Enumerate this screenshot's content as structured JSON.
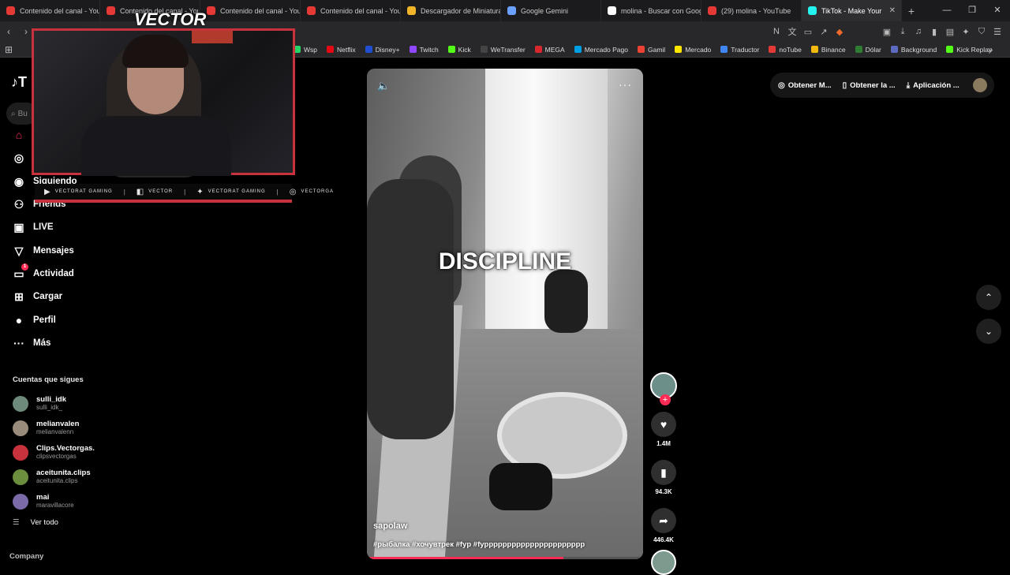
{
  "browser": {
    "tabs": [
      {
        "label": "Contenido del canal - You",
        "color": "#e53935"
      },
      {
        "label": "Contenido del canal - You",
        "color": "#e53935"
      },
      {
        "label": "Contenido del canal - You",
        "color": "#e53935"
      },
      {
        "label": "Contenido del canal - You",
        "color": "#e53935"
      },
      {
        "label": "Descargador de Miniatura",
        "color": "#f0b429"
      },
      {
        "label": "Google Gemini",
        "color": "#6aa0ff"
      },
      {
        "label": "molina - Buscar con Goog",
        "color": "#ffffff"
      },
      {
        "label": "(29) molina - YouTube",
        "color": "#e53935"
      },
      {
        "label": "TikTok - Make Your",
        "color": "#25f4ee",
        "active": true
      }
    ],
    "address_fragment": "s",
    "bookmarks": [
      {
        "label": "Wsp",
        "color": "#25d366"
      },
      {
        "label": "Netflix",
        "color": "#e50914"
      },
      {
        "label": "Disney+",
        "color": "#1f4fd0"
      },
      {
        "label": "Twitch",
        "color": "#9146ff"
      },
      {
        "label": "Kick",
        "color": "#53fc18"
      },
      {
        "label": "WeTransfer",
        "color": "#444444"
      },
      {
        "label": "MEGA",
        "color": "#d9272e"
      },
      {
        "label": "Mercado Pago",
        "color": "#009ee3"
      },
      {
        "label": "Gamil",
        "color": "#ea4335"
      },
      {
        "label": "Mercado",
        "color": "#ffe600"
      },
      {
        "label": "Traductor",
        "color": "#4285f4"
      },
      {
        "label": "noTube",
        "color": "#e53935"
      },
      {
        "label": "Binance",
        "color": "#f0b90b"
      },
      {
        "label": "Dólar",
        "color": "#2e7d32"
      },
      {
        "label": "Background",
        "color": "#5c6bc0"
      },
      {
        "label": "Kick Replay",
        "color": "#53fc18"
      }
    ]
  },
  "sidebar": {
    "logo": "♪T",
    "search_placeholder": "Bu",
    "items": [
      {
        "label": "",
        "icon": "home-icon"
      },
      {
        "label": "",
        "icon": "compass-icon"
      },
      {
        "label": "Siguiendo",
        "icon": "following-icon"
      },
      {
        "label": "Friends",
        "icon": "friends-icon"
      },
      {
        "label": "LIVE",
        "icon": "live-icon"
      },
      {
        "label": "Mensajes",
        "icon": "messages-icon"
      },
      {
        "label": "Actividad",
        "icon": "activity-icon",
        "badge": "1"
      },
      {
        "label": "Cargar",
        "icon": "upload-icon"
      },
      {
        "label": "Perfil",
        "icon": "profile-icon"
      },
      {
        "label": "Más",
        "icon": "more-icon"
      }
    ],
    "following_title": "Cuentas que sigues",
    "accounts": [
      {
        "name": "sulli_idk",
        "handle": "sulli_idk_",
        "color": "#6d8a7a"
      },
      {
        "name": "melianvalen",
        "handle": "melianvalenn",
        "color": "#9a8c7c"
      },
      {
        "name": "Clips.Vectorgas.",
        "handle": "clipsvectorgas",
        "color": "#c8323c"
      },
      {
        "name": "aceitunita.clips",
        "handle": "aceitunita.clips",
        "color": "#6b8e3e"
      },
      {
        "name": "mai",
        "handle": "maravillacore",
        "color": "#7a6aa8"
      }
    ],
    "see_all": "Ver todo",
    "company": "Company"
  },
  "overlay": {
    "logo_text": "VECTOR",
    "socials": [
      {
        "icon": "youtube-icon",
        "label": "VECTORAT GAMING"
      },
      {
        "icon": "twitch-icon",
        "label": "VECTOR"
      },
      {
        "icon": "twitter-icon",
        "label": "VECTORAT GAMING"
      },
      {
        "icon": "instagram-icon",
        "label": "VECTORGA"
      }
    ]
  },
  "video": {
    "caption": "DISCIPLINE",
    "author": "sapolaw",
    "hashtags": "#рыбалка #хочувтрек #fyp #fypppppppppppppppppppppp",
    "progress": 0.71,
    "likes": "1.4M",
    "saves": "94.3K",
    "shares": "446.4K"
  },
  "header": {
    "btn1": "Obtener M...",
    "btn2": "Obtener la ...",
    "btn3": "Aplicación ..."
  }
}
